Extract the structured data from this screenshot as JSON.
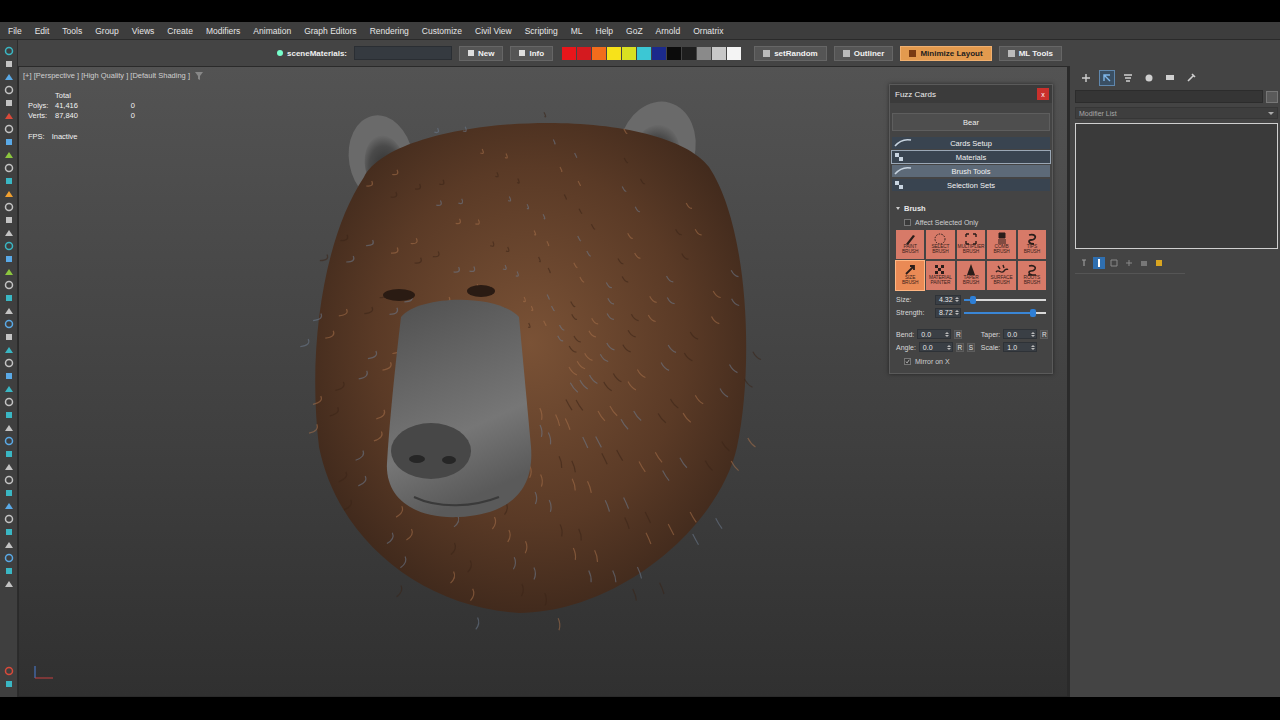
{
  "menu": [
    "File",
    "Edit",
    "Tools",
    "Group",
    "Views",
    "Create",
    "Modifiers",
    "Animation",
    "Graph Editors",
    "Rendering",
    "Customize",
    "Civil View",
    "Scripting",
    "ML",
    "Help",
    "GoZ",
    "Arnold",
    "Ornatrix"
  ],
  "toolbar": {
    "scene_label": "sceneMaterials:",
    "scene_value": "",
    "buttons_before": [
      {
        "label": "New",
        "selected": false
      },
      {
        "label": "Info",
        "selected": false
      }
    ],
    "swatches": [
      {
        "color": "#e8161b"
      },
      {
        "color": "#d41a1f"
      },
      {
        "color": "#f26c1c"
      },
      {
        "color": "#f7e21a"
      },
      {
        "color": "#d9e021"
      },
      {
        "color": "#3cc7d4"
      },
      {
        "color": "#1b2a8c"
      },
      {
        "color": "#0b0b0b"
      },
      {
        "color": "#1e1e1e"
      },
      {
        "color": "#8a8a8a"
      },
      {
        "color": "#c8c8c8"
      },
      {
        "color": "#f4f4f4"
      }
    ],
    "buttons_after": [
      {
        "label": "setRandom",
        "selected": false
      },
      {
        "label": "Outliner",
        "selected": false
      },
      {
        "label": "Minimize Layout",
        "selected": true
      },
      {
        "label": "ML Tools",
        "selected": false
      }
    ]
  },
  "viewport": {
    "label": "[+] [Perspective ] [High Quality ] [Default Shading ]",
    "stats_header": "Total",
    "stats": [
      {
        "label": "Polys:",
        "total": "41,416",
        "selection": "0"
      },
      {
        "label": "Verts:",
        "total": "87,840",
        "selection": "0"
      }
    ],
    "fps": {
      "label": "FPS:",
      "value": "Inactive"
    }
  },
  "fuzz_cards": {
    "title": "Fuzz Cards",
    "close": "x",
    "preset": "Bear",
    "rollouts": [
      {
        "label": "Cards Setup",
        "selected": false,
        "focused": false
      },
      {
        "label": "Materials",
        "selected": false,
        "focused": true
      },
      {
        "label": "Brush Tools",
        "selected": true,
        "focused": false
      },
      {
        "label": "Selection Sets",
        "selected": false,
        "focused": false
      }
    ],
    "brush": {
      "title": "Brush",
      "expanded": true,
      "affect_selected": {
        "label": "Affect Selected Only",
        "checked": false
      },
      "tools": [
        {
          "label": "PAINT BRUSH",
          "selected": false
        },
        {
          "label": "SELECT BRUSH",
          "selected": false
        },
        {
          "label": "MULTIPLIER BRUSH",
          "selected": false
        },
        {
          "label": "COMB BRUSH",
          "selected": false
        },
        {
          "label": "TIPS BRUSH",
          "selected": false
        },
        {
          "label": "SIZE BRUSH",
          "selected": true
        },
        {
          "label": "MATERIAL PAINTER",
          "selected": false
        },
        {
          "label": "TAPER BRUSH",
          "selected": false
        },
        {
          "label": "SURFACE BRUSH",
          "selected": false
        },
        {
          "label": "ROOTS BRUSH",
          "selected": false
        }
      ],
      "sliders": [
        {
          "label": "Size:",
          "reading": "4.32",
          "level": 0.11
        },
        {
          "label": "Strength:",
          "reading": "8.72",
          "level": 0.84
        }
      ],
      "fields": [
        {
          "label": "Bend:",
          "value": "0.0",
          "buttons": [
            "R"
          ]
        },
        {
          "label": "Taper:",
          "value": "0.0",
          "buttons": [
            "R"
          ]
        },
        {
          "label": "Angle:",
          "value": "0.0",
          "buttons": [
            "R",
            "S"
          ]
        },
        {
          "label": "Scale:",
          "value": "1.0",
          "buttons": []
        }
      ],
      "mirror": {
        "label": "Mirror on X",
        "checked": true
      }
    }
  },
  "command_panel": {
    "tabs": [
      {
        "selected": false
      },
      {
        "selected": true
      },
      {
        "selected": false
      },
      {
        "selected": false
      },
      {
        "selected": false
      },
      {
        "selected": false
      }
    ],
    "name_value": "",
    "modifier_list": "Modifier List",
    "stack_tools": [
      {
        "selected": false
      },
      {
        "selected": true
      },
      {
        "selected": false
      },
      {
        "selected": false
      },
      {
        "selected": false
      },
      {
        "selected": false
      }
    ]
  }
}
